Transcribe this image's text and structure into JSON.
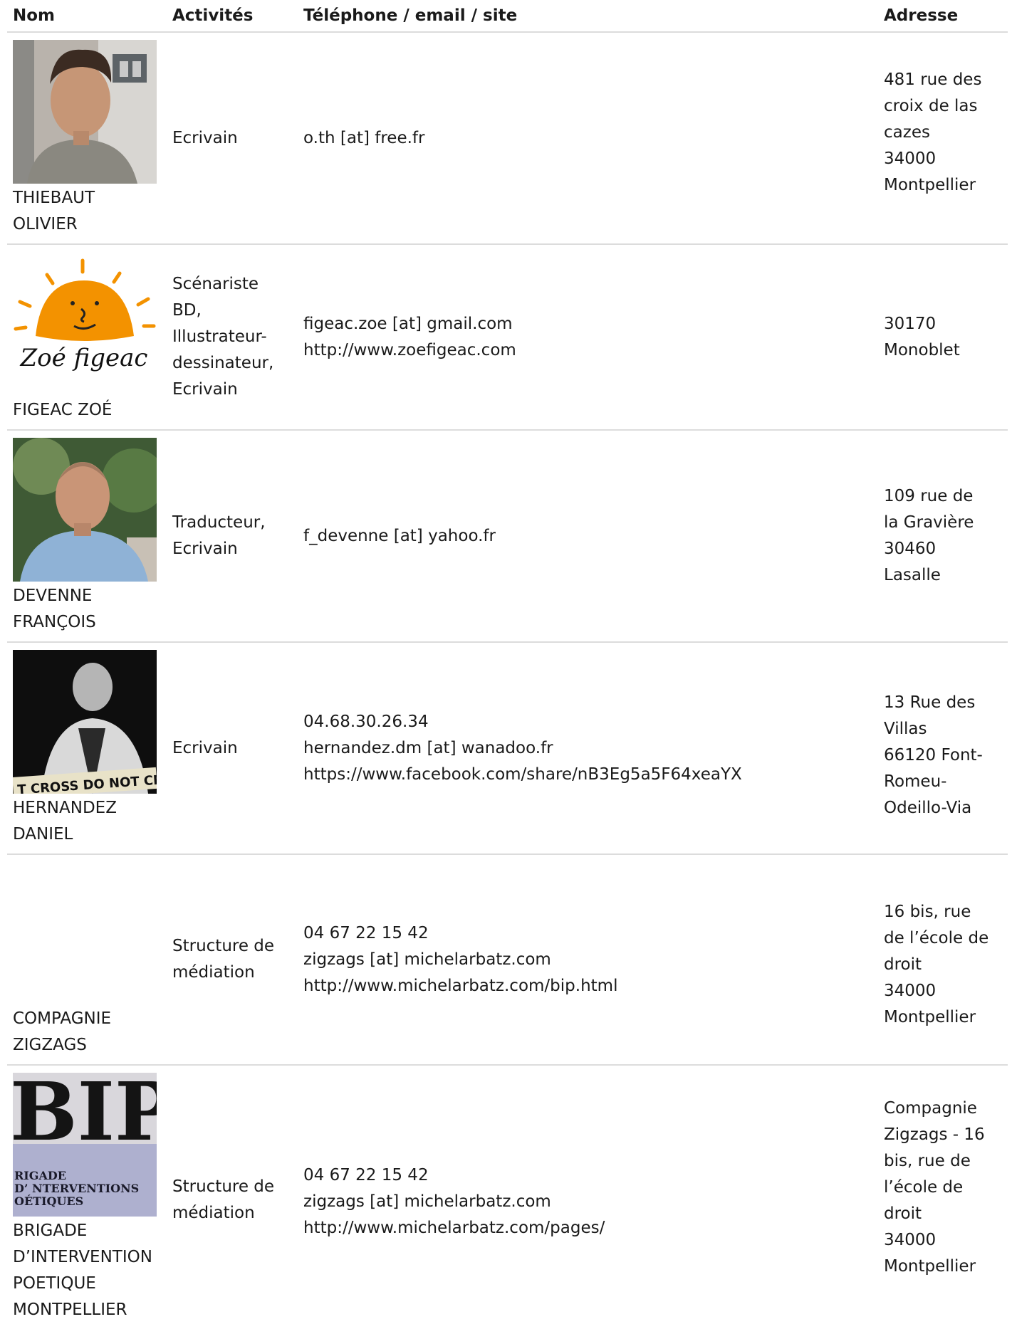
{
  "headers": {
    "name": "Nom",
    "activities": "Activités",
    "contact": "Téléphone / email / site",
    "address": "Adresse"
  },
  "rows": [
    {
      "name": [
        "THIEBAUT",
        "OLIVIER"
      ],
      "activities": [
        "Ecrivain"
      ],
      "contact": [
        "o.th [at] free.fr"
      ],
      "address": [
        "481 rue des",
        "croix de las",
        "cazes",
        "34000",
        "Montpellier"
      ]
    },
    {
      "name": [
        "FIGEAC ZOÉ"
      ],
      "activities": [
        "Scénariste",
        "BD,",
        "Illustrateur-",
        "dessinateur,",
        "Ecrivain"
      ],
      "contact": [
        "figeac.zoe [at] gmail.com",
        "http://www.zoefigeac.com"
      ],
      "address": [
        "30170",
        "Monoblet"
      ],
      "logo_text": "Zoé figeac"
    },
    {
      "name": [
        "DEVENNE",
        "FRANÇOIS"
      ],
      "activities": [
        "Traducteur,",
        "Ecrivain"
      ],
      "contact": [
        "f_devenne [at] yahoo.fr"
      ],
      "address": [
        "109 rue de",
        "la Gravière",
        "30460",
        "Lasalle"
      ]
    },
    {
      "name": [
        "HERNANDEZ",
        "DANIEL"
      ],
      "activities": [
        "Ecrivain"
      ],
      "contact": [
        "04.68.30.26.34",
        "hernandez.dm [at] wanadoo.fr",
        "https://www.facebook.com/share/nB3Eg5a5F64xeaYX"
      ],
      "address": [
        "13 Rue des",
        "Villas",
        "66120 Font-",
        "Romeu-",
        "Odeillo-Via"
      ],
      "tape_text": "T CROSS DO NOT CROSS"
    },
    {
      "name": [
        "COMPAGNIE",
        "ZIGZAGS"
      ],
      "activities": [
        "Structure de",
        "médiation"
      ],
      "contact": [
        "04 67 22 15 42",
        "zigzags [at] michelarbatz.com",
        "http://www.michelarbatz.com/bip.html"
      ],
      "address": [
        "16 bis, rue",
        "de l’école de",
        "droit",
        "34000",
        "Montpellier"
      ]
    },
    {
      "name": [
        "BRIGADE",
        "D’INTERVENTION",
        "POETIQUE",
        "MONTPELLIER"
      ],
      "activities": [
        "Structure de",
        "médiation"
      ],
      "contact": [
        "04 67 22 15 42",
        "zigzags [at] michelarbatz.com",
        "http://www.michelarbatz.com/pages/"
      ],
      "address": [
        "Compagnie",
        "Zigzags - 16",
        "bis, rue de",
        "l’école de",
        "droit",
        "34000",
        "Montpellier"
      ],
      "poster_text": [
        "BIP",
        "RIGADE",
        "D’ NTERVENTIONS",
        "OÉTIQUES"
      ]
    }
  ],
  "colors": {
    "divider": "#dcdcdc",
    "text": "#1a1a1a",
    "zoe_orange": "#f39200"
  }
}
